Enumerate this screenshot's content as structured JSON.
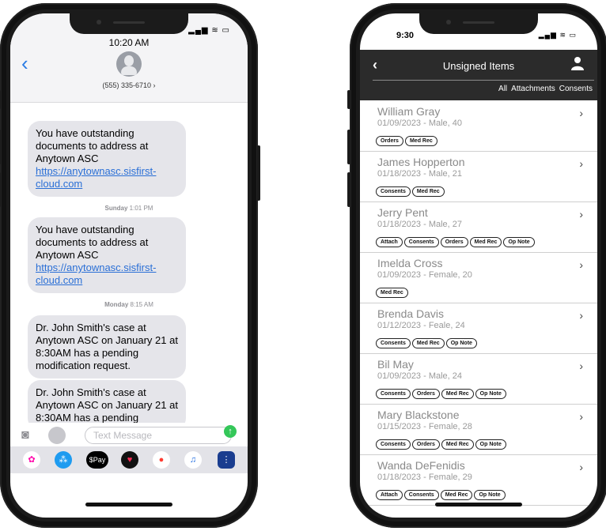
{
  "left_phone": {
    "status_icons": "▂▄▆ ≋ ▭",
    "header": {
      "time": "10:20 AM",
      "contact_number": "(555) 335-6710 ›"
    },
    "messages": [
      {
        "text": "You have outstanding documents to address at Anytown ASC",
        "link": "https://anytownasc.sisfirst-cloud.com"
      },
      {
        "text": "You have outstanding documents to address at Anytown ASC",
        "link": "https://anytownasc.sisfirst-cloud.com"
      },
      {
        "text": "Dr. John Smith's case at Anytown ASC on January 21 at 8:30AM has a pending modification request.",
        "link": ""
      },
      {
        "text": "Dr. John Smith's case at Anytown ASC on January 21 at 8:30AM has a pending",
        "link": ""
      }
    ],
    "timestamps": [
      {
        "day": "Sunday",
        "time": "1:01 PM"
      },
      {
        "day": "Monday",
        "time": "8:15 AM"
      }
    ],
    "compose": {
      "placeholder": "Text Message"
    },
    "tray": {
      "pay_label": "$Pay"
    }
  },
  "right_phone": {
    "status_time": "9:30",
    "status_icons": "▂▄▆ ≋ ▭",
    "header": {
      "back": "‹",
      "title": "Unsigned Items",
      "tabs": [
        "All",
        "Attachments",
        "Consents"
      ]
    },
    "items": [
      {
        "name": "William Gray",
        "meta": "01/09/2023 - Male, 40",
        "tags": [
          "Orders",
          "Med Rec"
        ]
      },
      {
        "name": "James Hopperton",
        "meta": "01/18/2023 - Male, 21",
        "tags": [
          "Consents",
          "Med Rec"
        ]
      },
      {
        "name": "Jerry Pent",
        "meta": "01/18/2023 - Male, 27",
        "tags": [
          "Attach",
          "Consents",
          "Orders",
          "Med Rec",
          "Op Note"
        ]
      },
      {
        "name": "Imelda Cross",
        "meta": "01/09/2023 - Female, 20",
        "tags": [
          "Med Rec"
        ]
      },
      {
        "name": "Brenda Davis",
        "meta": "01/12/2023 - Feale, 24",
        "tags": [
          "Consents",
          "Med Rec",
          "Op Note"
        ]
      },
      {
        "name": "Bil May",
        "meta": "01/09/2023 - Male, 24",
        "tags": [
          "Consents",
          "Orders",
          "Med Rec",
          "Op Note"
        ]
      },
      {
        "name": "Mary Blackstone",
        "meta": "01/15/2023 - Female, 28",
        "tags": [
          "Consents",
          "Orders",
          "Med Rec",
          "Op Note"
        ]
      },
      {
        "name": "Wanda DeFenidis",
        "meta": "01/18/2023 - Female, 29",
        "tags": [
          "Attach",
          "Consents",
          "Med Rec",
          "Op Note"
        ]
      }
    ]
  }
}
